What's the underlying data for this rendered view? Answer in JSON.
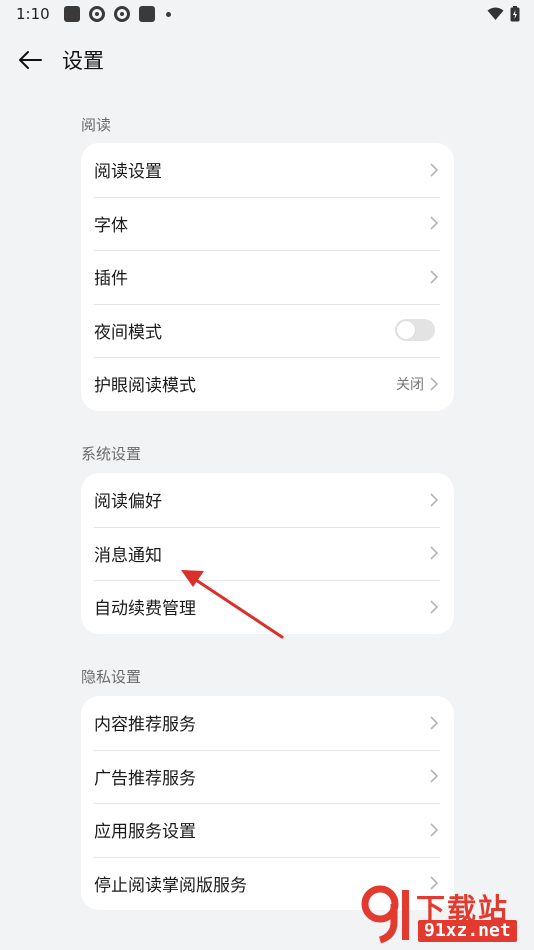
{
  "status_bar": {
    "time": "1:10",
    "notification_icons": [
      "app-notification-icon",
      "sync-icon",
      "sync-icon",
      "app-notification-icon"
    ],
    "right_icons": [
      "wifi-icon",
      "battery-icon"
    ]
  },
  "header": {
    "title": "设置",
    "back_icon": "back-arrow-icon"
  },
  "sections": {
    "reading": {
      "label": "阅读",
      "items": [
        {
          "label": "阅读设置"
        },
        {
          "label": "字体"
        },
        {
          "label": "插件"
        },
        {
          "label": "夜间模式",
          "toggle": false
        },
        {
          "label": "护眼阅读模式",
          "value": "关闭"
        }
      ]
    },
    "system": {
      "label": "系统设置",
      "items": [
        {
          "label": "阅读偏好"
        },
        {
          "label": "消息通知"
        },
        {
          "label": "自动续费管理"
        }
      ]
    },
    "privacy": {
      "label": "隐私设置",
      "items": [
        {
          "label": "内容推荐服务"
        },
        {
          "label": "广告推荐服务"
        },
        {
          "label": "应用服务设置"
        },
        {
          "label": "停止阅读掌阅版服务"
        }
      ]
    }
  },
  "watermark": {
    "text": "下载站",
    "url": "91xz.net",
    "color": "#e23a2e"
  },
  "colors": {
    "background": "#f1f3f5",
    "card": "#ffffff",
    "annotation_arrow": "#d9302b"
  }
}
